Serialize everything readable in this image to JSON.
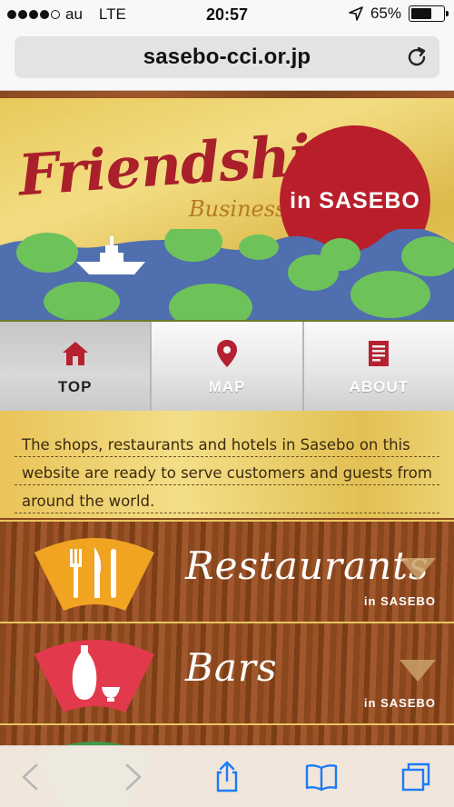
{
  "status": {
    "carrier": "au",
    "network": "LTE",
    "time": "20:57",
    "battery": "65%",
    "battery_level": 0.65,
    "signal_bars": 4
  },
  "browser": {
    "url": "sasebo-cci.or.jp"
  },
  "banner": {
    "title": "Friendship",
    "subtitle": "Business",
    "badge": "in SASEBO"
  },
  "nav": [
    {
      "label": "TOP",
      "icon": "home-icon"
    },
    {
      "label": "MAP",
      "icon": "map-pin-icon"
    },
    {
      "label": "ABOUT",
      "icon": "document-icon"
    }
  ],
  "intro": {
    "text": "The shops, restaurants and hotels in Sasebo on this website are ready to serve customers and guests from around the world."
  },
  "categories": [
    {
      "name": "Restaurants",
      "sub": "in SASEBO",
      "icon": "cutlery-icon",
      "fan_color": "#f0a422"
    },
    {
      "name": "Bars",
      "sub": "in SASEBO",
      "icon": "sake-bottle-icon",
      "fan_color": "#e23a4c"
    }
  ],
  "colors": {
    "brand_red": "#a9202b",
    "gold": "#e9cd63",
    "wood": "#8a461c"
  }
}
